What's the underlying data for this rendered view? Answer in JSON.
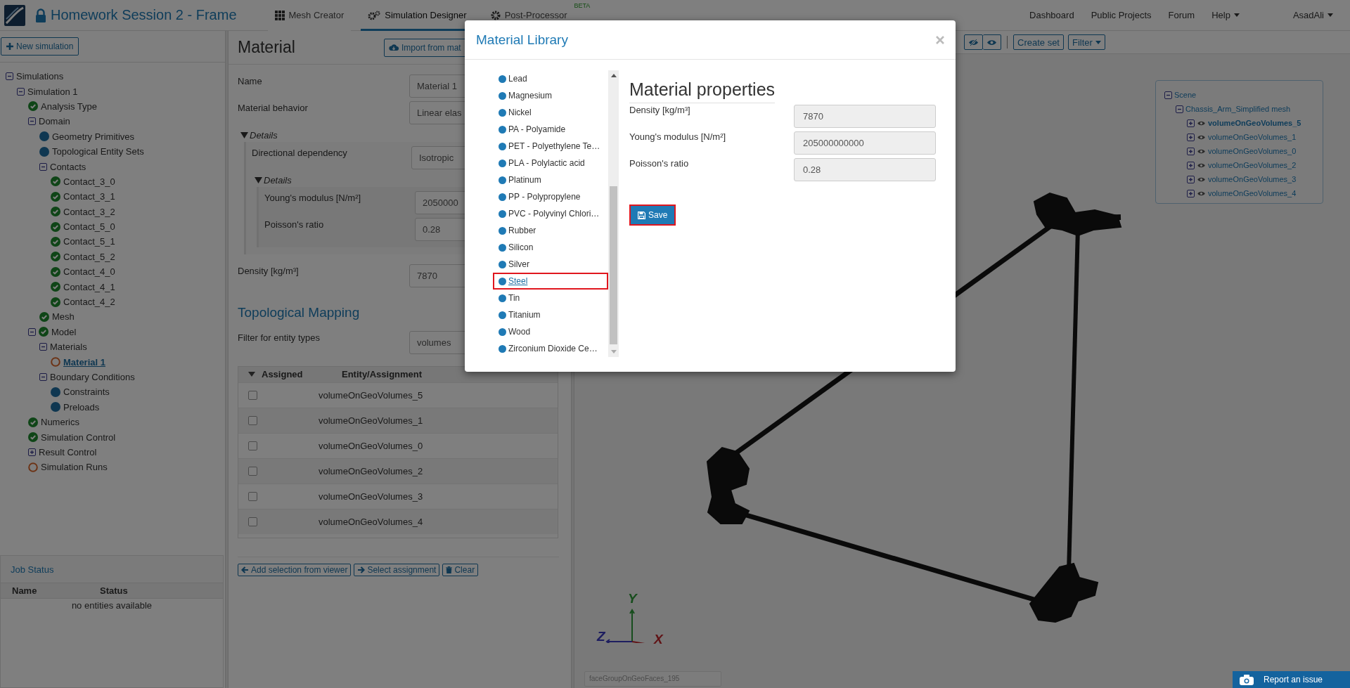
{
  "app": {
    "title": "Homework Session 2 - Frame"
  },
  "nav_tabs": [
    {
      "label": "Mesh Creator",
      "selected": false
    },
    {
      "label": "Simulation Designer",
      "selected": true
    },
    {
      "label": "Post-Processor",
      "selected": false,
      "badge": "BETA"
    }
  ],
  "nav_links": [
    {
      "label": "Dashboard",
      "dropdown": false
    },
    {
      "label": "Public Projects",
      "dropdown": false
    },
    {
      "label": "Forum",
      "dropdown": false
    },
    {
      "label": "Help",
      "dropdown": true
    },
    {
      "label": "AsadAli",
      "dropdown": true
    }
  ],
  "sidebar": {
    "new_button": "New simulation",
    "tree": [
      {
        "label": "Simulations",
        "expanded": true,
        "selected": false,
        "children": [
          {
            "label": "Simulation 1",
            "expanded": true,
            "selected": false,
            "children": [
              {
                "label": "Analysis Type",
                "kind": "ok",
                "selected": false
              },
              {
                "label": "Domain",
                "expanded": true,
                "selected": false,
                "children": [
                  {
                    "label": "Geometry Primitives",
                    "kind": "info",
                    "selected": false
                  },
                  {
                    "label": "Topological Entity Sets",
                    "kind": "info",
                    "selected": false
                  },
                  {
                    "label": "Contacts",
                    "expanded": true,
                    "selected": false,
                    "children": [
                      {
                        "label": "Contact_3_0",
                        "kind": "ok",
                        "selected": false
                      },
                      {
                        "label": "Contact_3_1",
                        "kind": "ok",
                        "selected": false
                      },
                      {
                        "label": "Contact_3_2",
                        "kind": "ok",
                        "selected": false
                      },
                      {
                        "label": "Contact_5_0",
                        "kind": "ok",
                        "selected": false
                      },
                      {
                        "label": "Contact_5_1",
                        "kind": "ok",
                        "selected": false
                      },
                      {
                        "label": "Contact_5_2",
                        "kind": "ok",
                        "selected": false
                      },
                      {
                        "label": "Contact_4_0",
                        "kind": "ok",
                        "selected": false
                      },
                      {
                        "label": "Contact_4_1",
                        "kind": "ok",
                        "selected": false
                      },
                      {
                        "label": "Contact_4_2",
                        "kind": "ok",
                        "selected": false
                      }
                    ]
                  },
                  {
                    "label": "Mesh",
                    "kind": "ok",
                    "selected": false
                  }
                ]
              },
              {
                "label": "Model",
                "expanded": true,
                "kind": "ok",
                "selected": false,
                "children": [
                  {
                    "label": "Materials",
                    "expanded": true,
                    "selected": false,
                    "children": [
                      {
                        "label": "Material 1",
                        "kind": "todo",
                        "selected": true
                      }
                    ]
                  },
                  {
                    "label": "Boundary Conditions",
                    "expanded": true,
                    "selected": false,
                    "children": [
                      {
                        "label": "Constraints",
                        "kind": "info",
                        "selected": false
                      },
                      {
                        "label": "Preloads",
                        "kind": "info",
                        "selected": false
                      }
                    ]
                  }
                ]
              },
              {
                "label": "Numerics",
                "kind": "ok",
                "selected": false
              },
              {
                "label": "Simulation Control",
                "kind": "ok",
                "selected": false
              },
              {
                "label": "Result Control",
                "expanded": false,
                "selected": false
              },
              {
                "label": "Simulation Runs",
                "kind": "todo",
                "selected": false
              }
            ]
          }
        ]
      }
    ]
  },
  "job_status": {
    "title": "Job Status",
    "columns": [
      "Name",
      "Status"
    ],
    "empty_text": "no entities available"
  },
  "material_panel": {
    "title": "Material",
    "import_button": "Import from mat",
    "name_field": {
      "label": "Name",
      "value": "Material 1"
    },
    "behavior_field": {
      "label": "Material behavior",
      "value": "Linear elas"
    },
    "details": {
      "title": "Details",
      "expanded": true,
      "field": {
        "label": "Directional dependency",
        "value": "Isotropic"
      },
      "details": {
        "title": "Details",
        "expanded": true,
        "fields": [
          {
            "label": "Young's modulus [N/m²]",
            "value": "2050000"
          },
          {
            "label": "Poisson's ratio",
            "value": "0.28"
          }
        ]
      }
    },
    "density_field": {
      "label": "Density [kg/m³]",
      "value": "7870"
    }
  },
  "topological_mapping": {
    "title": "Topological Mapping",
    "filter": {
      "label": "Filter for entity types",
      "value": "volumes"
    },
    "columns": [
      "Assigned",
      "Entity/Assignment"
    ],
    "rows": [
      {
        "name": "volumeOnGeoVolumes_5",
        "checked": false
      },
      {
        "name": "volumeOnGeoVolumes_1",
        "checked": false
      },
      {
        "name": "volumeOnGeoVolumes_0",
        "checked": false
      },
      {
        "name": "volumeOnGeoVolumes_2",
        "checked": false
      },
      {
        "name": "volumeOnGeoVolumes_3",
        "checked": false
      },
      {
        "name": "volumeOnGeoVolumes_4",
        "checked": false
      }
    ],
    "buttons": [
      "Add selection from viewer",
      "Select assignment",
      "Clear"
    ]
  },
  "viewer": {
    "toolbar_buttons": [
      {
        "label": "Create set",
        "dropdown": false
      },
      {
        "label": "Filter",
        "dropdown": true
      }
    ],
    "scene_tree": {
      "label": "Scene",
      "expanded": true,
      "selected": false,
      "children": [
        {
          "label": "Chassis_Arm_Simplified mesh",
          "expanded": true,
          "selected": false,
          "children": [
            {
              "label": "volumeOnGeoVolumes_5",
              "expanded": false,
              "selected": true
            },
            {
              "label": "volumeOnGeoVolumes_1",
              "expanded": false,
              "selected": false
            },
            {
              "label": "volumeOnGeoVolumes_0",
              "expanded": false,
              "selected": false
            },
            {
              "label": "volumeOnGeoVolumes_2",
              "expanded": false,
              "selected": false
            },
            {
              "label": "volumeOnGeoVolumes_3",
              "expanded": false,
              "selected": false
            },
            {
              "label": "volumeOnGeoVolumes_4",
              "expanded": false,
              "selected": false
            }
          ]
        }
      ]
    },
    "axes": {
      "x": "X",
      "y": "Y",
      "z": "Z"
    },
    "hover_label": "faceGroupOnGeoFaces_195"
  },
  "report_button": "Report an issue",
  "modal": {
    "title": "Material Library",
    "materials": [
      {
        "name": "Lead",
        "selected": false
      },
      {
        "name": "Magnesium",
        "selected": false
      },
      {
        "name": "Nickel",
        "selected": false
      },
      {
        "name": "PA - Polyamide",
        "selected": false
      },
      {
        "name": "PET - Polyethylene Te…",
        "selected": false
      },
      {
        "name": "PLA - Polylactic acid",
        "selected": false
      },
      {
        "name": "Platinum",
        "selected": false
      },
      {
        "name": "PP - Polypropylene",
        "selected": false
      },
      {
        "name": "PVC - Polyvinyl Chlori…",
        "selected": false
      },
      {
        "name": "Rubber",
        "selected": false
      },
      {
        "name": "Silicon",
        "selected": false
      },
      {
        "name": "Silver",
        "selected": false
      },
      {
        "name": "Steel",
        "selected": true
      },
      {
        "name": "Tin",
        "selected": false
      },
      {
        "name": "Titanium",
        "selected": false
      },
      {
        "name": "Wood",
        "selected": false
      },
      {
        "name": "Zirconium Dioxide Ce…",
        "selected": false
      }
    ],
    "properties": {
      "title": "Material properties",
      "fields": [
        {
          "label": "Density [kg/m³]",
          "value": "7870"
        },
        {
          "label": "Young's modulus [N/m²]",
          "value": "205000000000"
        },
        {
          "label": "Poisson's ratio",
          "value": "0.28"
        }
      ]
    },
    "save_button": {
      "label": "Save",
      "highlighted": true
    }
  }
}
